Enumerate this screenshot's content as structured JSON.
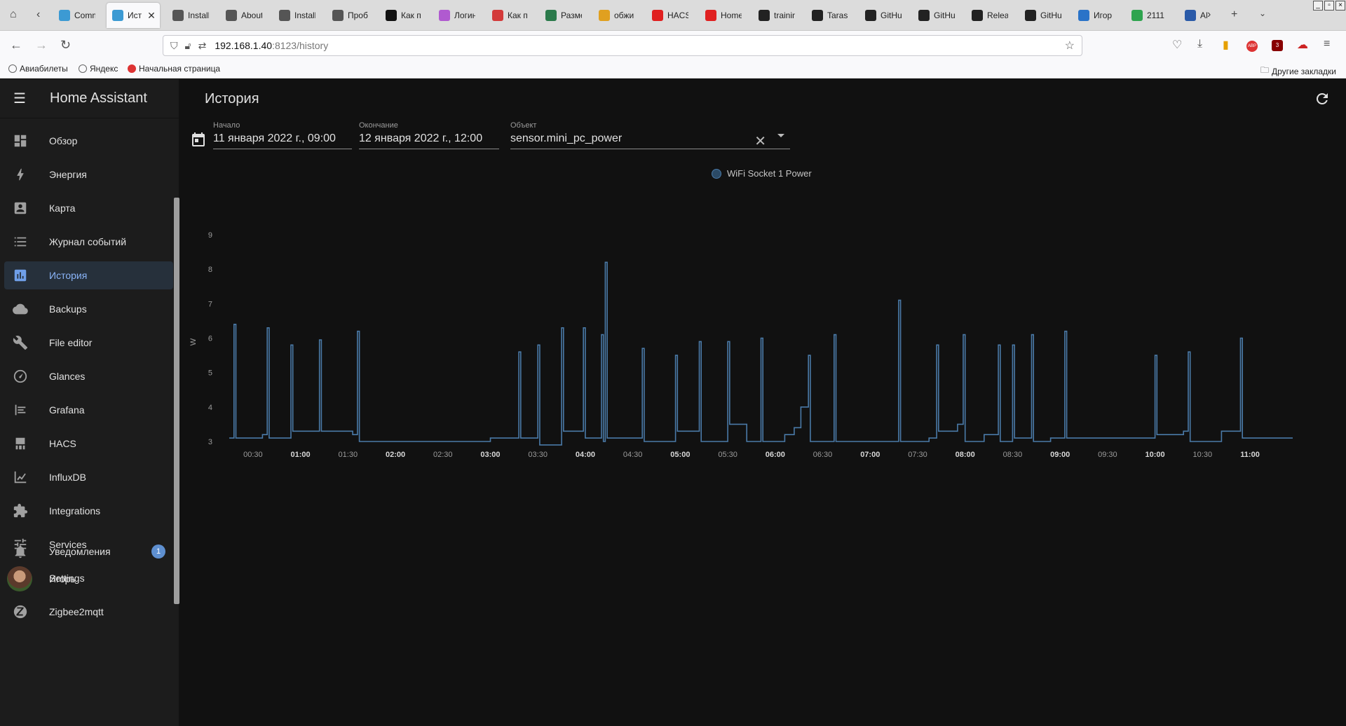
{
  "browser": {
    "tabs": [
      {
        "label": "Comm",
        "icon": "home-assistant-icon",
        "color": "#3c9ad3"
      },
      {
        "label": "Ист",
        "icon": "home-assistant-icon",
        "color": "#3c9ad3",
        "active": true
      },
      {
        "label": "Install",
        "icon": "bluetooth-icon",
        "color": "#555555"
      },
      {
        "label": "About",
        "icon": "bluetooth-icon",
        "color": "#555555"
      },
      {
        "label": "Install",
        "icon": "bluetooth-icon",
        "color": "#555555"
      },
      {
        "label": "Проб",
        "icon": "info-icon",
        "color": "#555555"
      },
      {
        "label": "Как п",
        "icon": "yandex-zen-icon",
        "color": "#111111"
      },
      {
        "label": "Логин",
        "icon": "colorful-icon",
        "color": "#b05ad0"
      },
      {
        "label": "Как п",
        "icon": "os-icon",
        "color": "#d33a3a"
      },
      {
        "label": "Разме",
        "icon": "z-icon",
        "color": "#2b7a4b"
      },
      {
        "label": "обжи",
        "icon": "image-icon",
        "color": "#e0a020"
      },
      {
        "label": "HACS",
        "icon": "youtube-icon",
        "color": "#e02020"
      },
      {
        "label": "Home",
        "icon": "youtube-icon",
        "color": "#e02020"
      },
      {
        "label": "trainin",
        "icon": "github-icon",
        "color": "#222222"
      },
      {
        "label": "TarasS",
        "icon": "github-icon",
        "color": "#222222"
      },
      {
        "label": "GitHu",
        "icon": "github-icon",
        "color": "#222222"
      },
      {
        "label": "GitHu",
        "icon": "github-icon",
        "color": "#222222"
      },
      {
        "label": "Relea",
        "icon": "github-icon",
        "color": "#222222"
      },
      {
        "label": "GitHu",
        "icon": "github-icon",
        "color": "#222222"
      },
      {
        "label": "Игор",
        "icon": "vk-icon",
        "color": "#2a73c8"
      },
      {
        "label": "2111",
        "icon": "google-drive-icon",
        "color": "#2fa44f"
      },
      {
        "label": "AL",
        "icon": "calendar-17-icon",
        "color": "#2a5aa8"
      }
    ],
    "url_host": "192.168.1.40",
    "url_path": ":8123/history",
    "bookmarks": [
      "Авиабилеты",
      "Яндекс",
      "Начальная страница"
    ],
    "other_bookmarks": "Другие закладки",
    "extension_badge": "3"
  },
  "sidebar": {
    "title": "Home Assistant",
    "items": [
      {
        "label": "Обзор",
        "icon": "dashboard-icon"
      },
      {
        "label": "Энергия",
        "icon": "lightning-icon"
      },
      {
        "label": "Карта",
        "icon": "map-person-icon"
      },
      {
        "label": "Журнал событий",
        "icon": "logbook-list-icon"
      },
      {
        "label": "История",
        "icon": "chart-bar-icon",
        "active": true
      },
      {
        "label": "Backups",
        "icon": "cloud-icon"
      },
      {
        "label": "File editor",
        "icon": "wrench-icon"
      },
      {
        "label": "Glances",
        "icon": "gauge-icon"
      },
      {
        "label": "Grafana",
        "icon": "grafana-icon"
      },
      {
        "label": "HACS",
        "icon": "hacs-icon"
      },
      {
        "label": "InfluxDB",
        "icon": "line-chart-icon"
      },
      {
        "label": "Integrations",
        "icon": "puzzle-icon"
      },
      {
        "label": "Services",
        "icon": "tune-icon"
      },
      {
        "label": "Settings",
        "icon": "tools-icon"
      },
      {
        "label": "Zigbee2mqtt",
        "icon": "zigbee-icon"
      }
    ],
    "notifications": {
      "label": "Уведомления",
      "count": "1"
    },
    "user": {
      "label": "Игорь"
    }
  },
  "main": {
    "title": "История",
    "start": {
      "label": "Начало",
      "value": "11 января 2022 г., 09:00"
    },
    "end": {
      "label": "Окончание",
      "value": "12 января 2022 г., 12:00"
    },
    "entity": {
      "label": "Объект",
      "value": "sensor.mini_pc_power"
    }
  },
  "chart_data": {
    "type": "line",
    "step": true,
    "series": [
      {
        "name": "WiFi Socket 1 Power",
        "color": "#4a7aa8"
      }
    ],
    "ylabel": "W",
    "ylim": [
      3,
      9
    ],
    "yticks": [
      "3",
      "4",
      "5",
      "6",
      "7",
      "8",
      "9"
    ],
    "xticks": [
      {
        "label": "00:30",
        "bold": false
      },
      {
        "label": "01:00",
        "bold": true
      },
      {
        "label": "01:30",
        "bold": false
      },
      {
        "label": "02:00",
        "bold": true
      },
      {
        "label": "02:30",
        "bold": false
      },
      {
        "label": "03:00",
        "bold": true
      },
      {
        "label": "03:30",
        "bold": false
      },
      {
        "label": "04:00",
        "bold": true
      },
      {
        "label": "04:30",
        "bold": false
      },
      {
        "label": "05:00",
        "bold": true
      },
      {
        "label": "05:30",
        "bold": false
      },
      {
        "label": "06:00",
        "bold": true
      },
      {
        "label": "06:30",
        "bold": false
      },
      {
        "label": "07:00",
        "bold": true
      },
      {
        "label": "07:30",
        "bold": false
      },
      {
        "label": "08:00",
        "bold": true
      },
      {
        "label": "08:30",
        "bold": false
      },
      {
        "label": "09:00",
        "bold": true
      },
      {
        "label": "09:30",
        "bold": false
      },
      {
        "label": "10:00",
        "bold": true
      },
      {
        "label": "10:30",
        "bold": false
      },
      {
        "label": "11:00",
        "bold": true
      }
    ],
    "x_hours": [
      0.25,
      11.45
    ],
    "points": [
      [
        0.25,
        3.1
      ],
      [
        0.3,
        3.1
      ],
      [
        0.3,
        6.4
      ],
      [
        0.32,
        6.4
      ],
      [
        0.32,
        3.1
      ],
      [
        0.6,
        3.1
      ],
      [
        0.6,
        3.2
      ],
      [
        0.65,
        3.2
      ],
      [
        0.65,
        6.3
      ],
      [
        0.67,
        6.3
      ],
      [
        0.67,
        3.1
      ],
      [
        0.9,
        3.1
      ],
      [
        0.9,
        5.8
      ],
      [
        0.92,
        5.8
      ],
      [
        0.92,
        3.3
      ],
      [
        1.2,
        3.3
      ],
      [
        1.2,
        5.95
      ],
      [
        1.22,
        5.95
      ],
      [
        1.22,
        3.3
      ],
      [
        1.55,
        3.3
      ],
      [
        1.55,
        3.2
      ],
      [
        1.6,
        3.2
      ],
      [
        1.6,
        6.2
      ],
      [
        1.62,
        6.2
      ],
      [
        1.62,
        3.0
      ],
      [
        3.0,
        3.0
      ],
      [
        3.0,
        3.1
      ],
      [
        3.3,
        3.1
      ],
      [
        3.3,
        5.6
      ],
      [
        3.32,
        5.6
      ],
      [
        3.32,
        3.1
      ],
      [
        3.5,
        3.1
      ],
      [
        3.5,
        5.8
      ],
      [
        3.52,
        5.8
      ],
      [
        3.52,
        2.9
      ],
      [
        3.75,
        2.9
      ],
      [
        3.75,
        6.3
      ],
      [
        3.77,
        6.3
      ],
      [
        3.77,
        3.3
      ],
      [
        3.98,
        3.3
      ],
      [
        3.98,
        6.3
      ],
      [
        4.0,
        6.3
      ],
      [
        4.0,
        3.1
      ],
      [
        4.17,
        3.1
      ],
      [
        4.17,
        6.1
      ],
      [
        4.19,
        6.1
      ],
      [
        4.19,
        3.0
      ],
      [
        4.21,
        3.0
      ],
      [
        4.21,
        8.2
      ],
      [
        4.23,
        8.2
      ],
      [
        4.23,
        3.1
      ],
      [
        4.6,
        3.1
      ],
      [
        4.6,
        5.7
      ],
      [
        4.62,
        5.7
      ],
      [
        4.62,
        3.0
      ],
      [
        4.95,
        3.0
      ],
      [
        4.95,
        5.5
      ],
      [
        4.97,
        5.5
      ],
      [
        4.97,
        3.3
      ],
      [
        5.2,
        3.3
      ],
      [
        5.2,
        5.9
      ],
      [
        5.22,
        5.9
      ],
      [
        5.22,
        3.0
      ],
      [
        5.5,
        3.0
      ],
      [
        5.5,
        5.9
      ],
      [
        5.52,
        5.9
      ],
      [
        5.52,
        3.5
      ],
      [
        5.7,
        3.5
      ],
      [
        5.7,
        3.0
      ],
      [
        5.85,
        3.0
      ],
      [
        5.85,
        6.0
      ],
      [
        5.87,
        6.0
      ],
      [
        5.87,
        3.0
      ],
      [
        6.1,
        3.0
      ],
      [
        6.1,
        3.2
      ],
      [
        6.2,
        3.2
      ],
      [
        6.2,
        3.4
      ],
      [
        6.27,
        3.4
      ],
      [
        6.27,
        4.0
      ],
      [
        6.35,
        4.0
      ],
      [
        6.35,
        5.5
      ],
      [
        6.37,
        5.5
      ],
      [
        6.37,
        3.0
      ],
      [
        6.62,
        3.0
      ],
      [
        6.62,
        6.1
      ],
      [
        6.64,
        6.1
      ],
      [
        6.64,
        3.0
      ],
      [
        7.3,
        3.0
      ],
      [
        7.3,
        7.1
      ],
      [
        7.32,
        7.1
      ],
      [
        7.32,
        3.0
      ],
      [
        7.62,
        3.0
      ],
      [
        7.62,
        3.1
      ],
      [
        7.7,
        3.1
      ],
      [
        7.7,
        5.8
      ],
      [
        7.72,
        5.8
      ],
      [
        7.72,
        3.3
      ],
      [
        7.92,
        3.3
      ],
      [
        7.92,
        3.5
      ],
      [
        7.98,
        3.5
      ],
      [
        7.98,
        6.1
      ],
      [
        8.0,
        6.1
      ],
      [
        8.0,
        3.0
      ],
      [
        8.2,
        3.0
      ],
      [
        8.2,
        3.2
      ],
      [
        8.35,
        3.2
      ],
      [
        8.35,
        5.8
      ],
      [
        8.37,
        5.8
      ],
      [
        8.37,
        3.0
      ],
      [
        8.5,
        3.0
      ],
      [
        8.5,
        5.8
      ],
      [
        8.52,
        5.8
      ],
      [
        8.52,
        3.1
      ],
      [
        8.7,
        3.1
      ],
      [
        8.7,
        6.1
      ],
      [
        8.72,
        6.1
      ],
      [
        8.72,
        3.0
      ],
      [
        8.9,
        3.0
      ],
      [
        8.9,
        3.1
      ],
      [
        9.05,
        3.1
      ],
      [
        9.05,
        6.2
      ],
      [
        9.07,
        6.2
      ],
      [
        9.07,
        3.1
      ],
      [
        10.0,
        3.1
      ],
      [
        10.0,
        5.5
      ],
      [
        10.02,
        5.5
      ],
      [
        10.02,
        3.2
      ],
      [
        10.3,
        3.2
      ],
      [
        10.3,
        3.3
      ],
      [
        10.35,
        3.3
      ],
      [
        10.35,
        5.6
      ],
      [
        10.37,
        5.6
      ],
      [
        10.37,
        3.0
      ],
      [
        10.7,
        3.0
      ],
      [
        10.7,
        3.3
      ],
      [
        10.9,
        3.3
      ],
      [
        10.9,
        6.0
      ],
      [
        10.92,
        6.0
      ],
      [
        10.92,
        3.1
      ],
      [
        11.45,
        3.1
      ]
    ]
  }
}
